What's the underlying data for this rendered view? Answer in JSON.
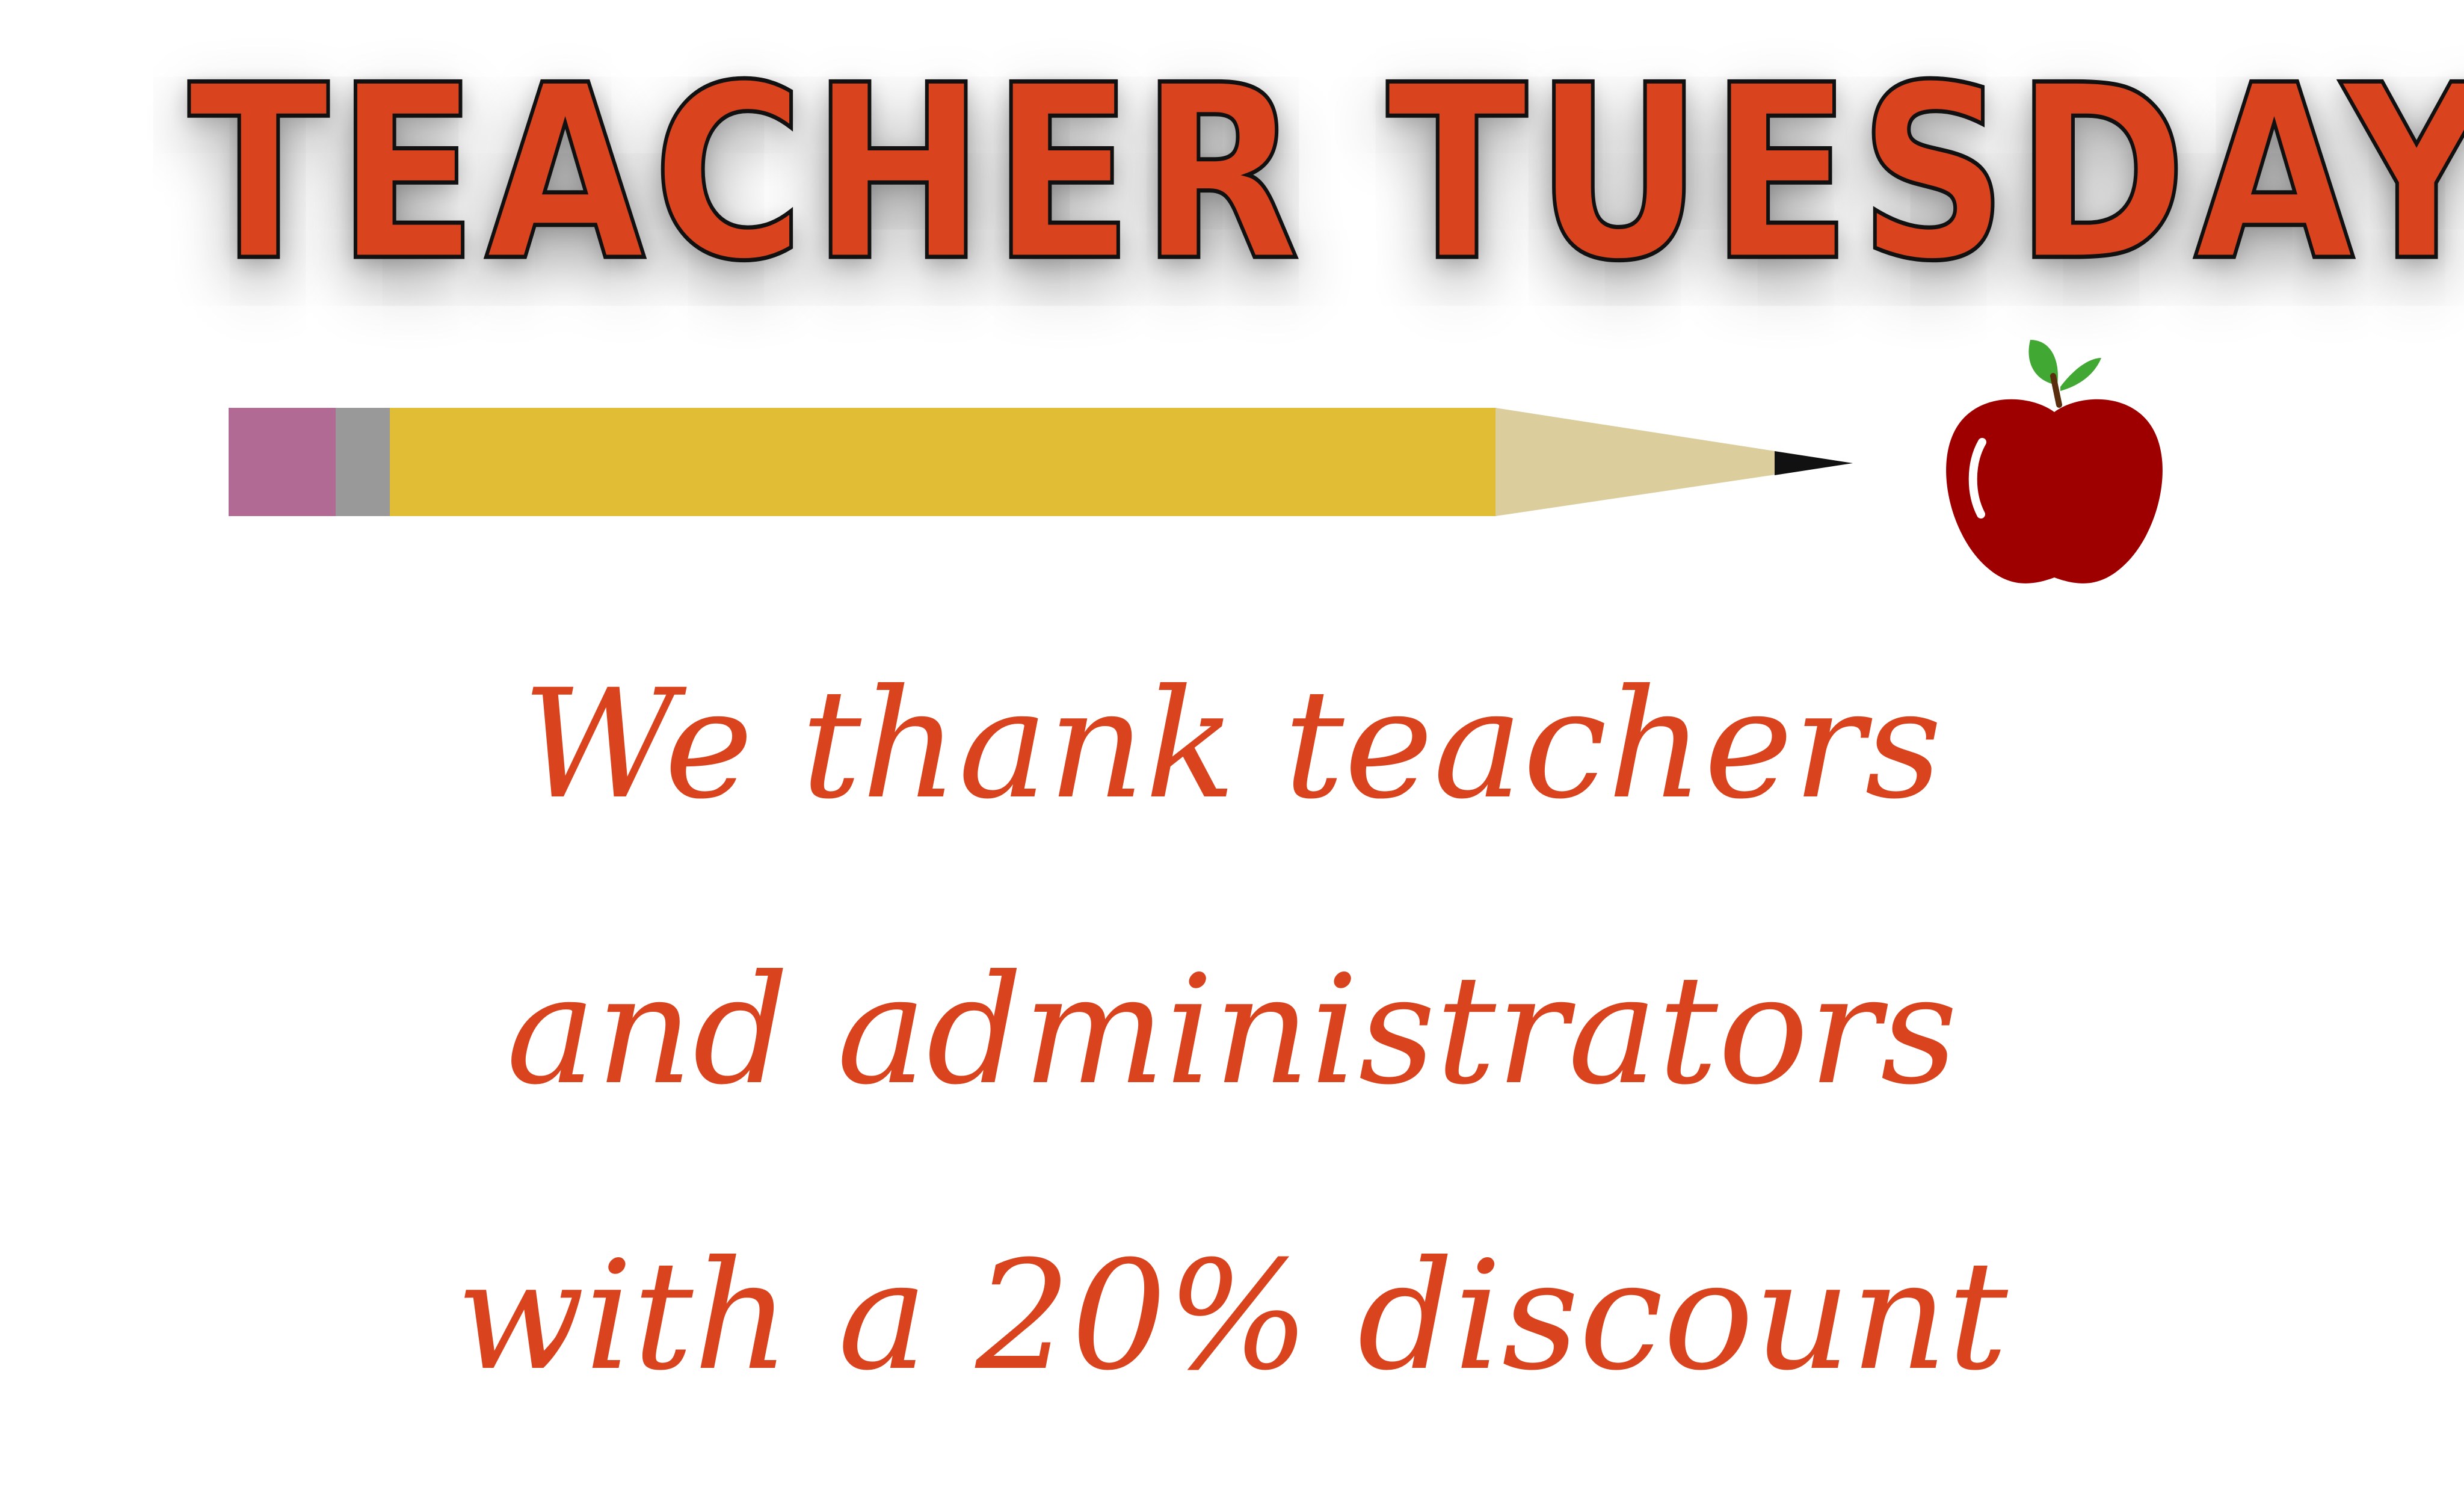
{
  "title": "TEACHER TUESDAY",
  "message": {
    "line1": "We thank teachers",
    "line2": "and administrators",
    "line3": "with a 20% discount"
  },
  "colors": {
    "title": "#d9441f",
    "text": "#d9441f",
    "pencil_eraser": "#b06a93",
    "pencil_ferrule": "#999999",
    "pencil_body": "#e1bd36",
    "pencil_wood": "#dbcd9c",
    "pencil_lead": "#111111",
    "apple": "#9e0000",
    "apple_leaf": "#41a834"
  },
  "icons": {
    "pencil": "pencil-icon",
    "apple": "apple-icon"
  }
}
